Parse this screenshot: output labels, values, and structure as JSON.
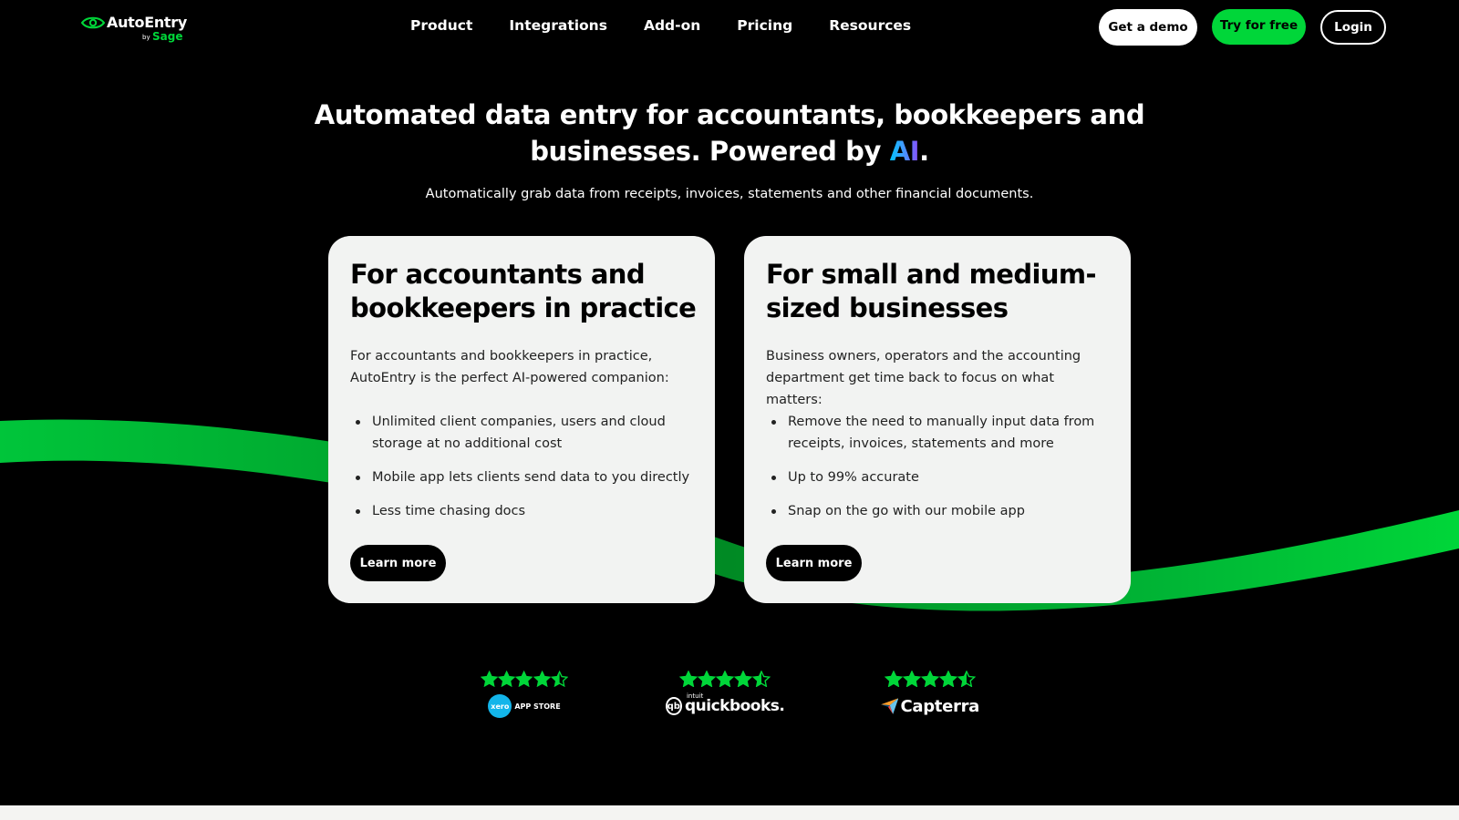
{
  "header": {
    "logo": {
      "name": "AutoEntry",
      "by": "by",
      "brand": "Sage"
    },
    "nav": [
      {
        "label": "Product"
      },
      {
        "label": "Integrations"
      },
      {
        "label": "Add-on"
      },
      {
        "label": "Pricing"
      },
      {
        "label": "Resources"
      }
    ],
    "buttons": {
      "demo": "Get a demo",
      "try": "Try for free",
      "login": "Login"
    }
  },
  "hero": {
    "title_line1": "Automated data entry for accountants, bookkeepers and",
    "title_line2_prefix": "businesses. Powered by ",
    "title_ai": "AI",
    "title_suffix": ".",
    "subtitle": "Automatically grab data from receipts, invoices, statements and other financial documents."
  },
  "cards": [
    {
      "title": "For accountants and bookkeepers in practice",
      "description": "For accountants and bookkeepers in practice, AutoEntry is the perfect AI-powered companion:",
      "bullets": [
        "Unlimited client companies, users and cloud storage at no additional cost",
        "Mobile app lets clients send data to you directly",
        "Less time chasing docs"
      ],
      "button": "Learn more"
    },
    {
      "title": "For small and medium-sized businesses",
      "description": "Business owners, operators and the accounting department get time back to focus on what matters:",
      "bullets": [
        "Remove the need to manually input data from receipts, invoices, statements and more",
        "Up to 99% accurate",
        "Snap on the go with our mobile app"
      ],
      "button": "Learn more"
    }
  ],
  "ratings": [
    {
      "platform": "xero",
      "label": "APP STORE",
      "mark": "xero",
      "stars": 4.5
    },
    {
      "platform": "quickbooks",
      "label": "quickbooks.",
      "intuit": "intuit",
      "mark": "qb",
      "stars": 4.5
    },
    {
      "platform": "capterra",
      "label": "Capterra",
      "stars": 4.5
    }
  ],
  "colors": {
    "background": "#000000",
    "accent_green": "#00d639",
    "card_bg": "#f2f3f2",
    "ai_gradient_start": "#00c2ff",
    "ai_gradient_end": "#8b4dff"
  }
}
